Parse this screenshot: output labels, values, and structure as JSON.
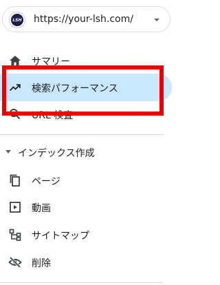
{
  "property": {
    "logo_text": "LSH",
    "url": "https://your-lsh.com/"
  },
  "nav": {
    "summary": "サマリー",
    "performance": "検索パフォーマンス",
    "url_inspection": "URL 検査"
  },
  "index_section": {
    "title": "インデックス作成",
    "items": [
      "ページ",
      "動画",
      "サイトマップ",
      "削除"
    ]
  },
  "colors": {
    "active_bg": "#c9e7ff",
    "highlight": "#ee0000"
  }
}
